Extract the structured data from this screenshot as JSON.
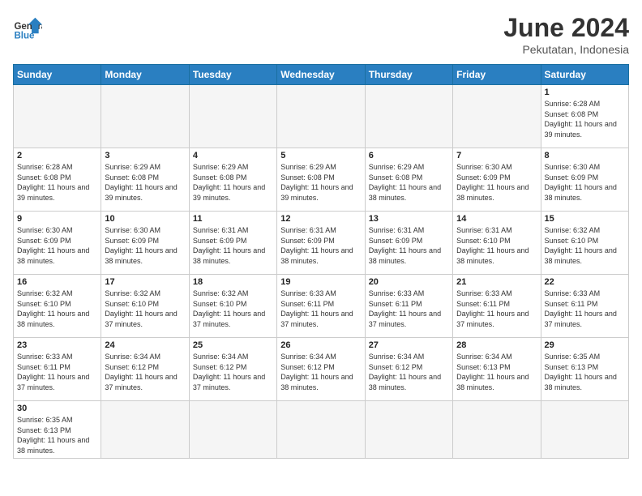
{
  "header": {
    "logo_general": "General",
    "logo_blue": "Blue",
    "month_title": "June 2024",
    "location": "Pekutatan, Indonesia"
  },
  "weekdays": [
    "Sunday",
    "Monday",
    "Tuesday",
    "Wednesday",
    "Thursday",
    "Friday",
    "Saturday"
  ],
  "weeks": [
    [
      {
        "day": "",
        "empty": true
      },
      {
        "day": "",
        "empty": true
      },
      {
        "day": "",
        "empty": true
      },
      {
        "day": "",
        "empty": true
      },
      {
        "day": "",
        "empty": true
      },
      {
        "day": "",
        "empty": true
      },
      {
        "day": "1",
        "sunrise": "6:28 AM",
        "sunset": "6:08 PM",
        "daylight": "11 hours and 39 minutes."
      }
    ],
    [
      {
        "day": "2",
        "sunrise": "6:28 AM",
        "sunset": "6:08 PM",
        "daylight": "11 hours and 39 minutes."
      },
      {
        "day": "3",
        "sunrise": "6:29 AM",
        "sunset": "6:08 PM",
        "daylight": "11 hours and 39 minutes."
      },
      {
        "day": "4",
        "sunrise": "6:29 AM",
        "sunset": "6:08 PM",
        "daylight": "11 hours and 39 minutes."
      },
      {
        "day": "5",
        "sunrise": "6:29 AM",
        "sunset": "6:08 PM",
        "daylight": "11 hours and 39 minutes."
      },
      {
        "day": "6",
        "sunrise": "6:29 AM",
        "sunset": "6:08 PM",
        "daylight": "11 hours and 38 minutes."
      },
      {
        "day": "7",
        "sunrise": "6:30 AM",
        "sunset": "6:09 PM",
        "daylight": "11 hours and 38 minutes."
      },
      {
        "day": "8",
        "sunrise": "6:30 AM",
        "sunset": "6:09 PM",
        "daylight": "11 hours and 38 minutes."
      }
    ],
    [
      {
        "day": "9",
        "sunrise": "6:30 AM",
        "sunset": "6:09 PM",
        "daylight": "11 hours and 38 minutes."
      },
      {
        "day": "10",
        "sunrise": "6:30 AM",
        "sunset": "6:09 PM",
        "daylight": "11 hours and 38 minutes."
      },
      {
        "day": "11",
        "sunrise": "6:31 AM",
        "sunset": "6:09 PM",
        "daylight": "11 hours and 38 minutes."
      },
      {
        "day": "12",
        "sunrise": "6:31 AM",
        "sunset": "6:09 PM",
        "daylight": "11 hours and 38 minutes."
      },
      {
        "day": "13",
        "sunrise": "6:31 AM",
        "sunset": "6:09 PM",
        "daylight": "11 hours and 38 minutes."
      },
      {
        "day": "14",
        "sunrise": "6:31 AM",
        "sunset": "6:10 PM",
        "daylight": "11 hours and 38 minutes."
      },
      {
        "day": "15",
        "sunrise": "6:32 AM",
        "sunset": "6:10 PM",
        "daylight": "11 hours and 38 minutes."
      }
    ],
    [
      {
        "day": "16",
        "sunrise": "6:32 AM",
        "sunset": "6:10 PM",
        "daylight": "11 hours and 38 minutes."
      },
      {
        "day": "17",
        "sunrise": "6:32 AM",
        "sunset": "6:10 PM",
        "daylight": "11 hours and 37 minutes."
      },
      {
        "day": "18",
        "sunrise": "6:32 AM",
        "sunset": "6:10 PM",
        "daylight": "11 hours and 37 minutes."
      },
      {
        "day": "19",
        "sunrise": "6:33 AM",
        "sunset": "6:11 PM",
        "daylight": "11 hours and 37 minutes."
      },
      {
        "day": "20",
        "sunrise": "6:33 AM",
        "sunset": "6:11 PM",
        "daylight": "11 hours and 37 minutes."
      },
      {
        "day": "21",
        "sunrise": "6:33 AM",
        "sunset": "6:11 PM",
        "daylight": "11 hours and 37 minutes."
      },
      {
        "day": "22",
        "sunrise": "6:33 AM",
        "sunset": "6:11 PM",
        "daylight": "11 hours and 37 minutes."
      }
    ],
    [
      {
        "day": "23",
        "sunrise": "6:33 AM",
        "sunset": "6:11 PM",
        "daylight": "11 hours and 37 minutes."
      },
      {
        "day": "24",
        "sunrise": "6:34 AM",
        "sunset": "6:12 PM",
        "daylight": "11 hours and 37 minutes."
      },
      {
        "day": "25",
        "sunrise": "6:34 AM",
        "sunset": "6:12 PM",
        "daylight": "11 hours and 37 minutes."
      },
      {
        "day": "26",
        "sunrise": "6:34 AM",
        "sunset": "6:12 PM",
        "daylight": "11 hours and 38 minutes."
      },
      {
        "day": "27",
        "sunrise": "6:34 AM",
        "sunset": "6:12 PM",
        "daylight": "11 hours and 38 minutes."
      },
      {
        "day": "28",
        "sunrise": "6:34 AM",
        "sunset": "6:13 PM",
        "daylight": "11 hours and 38 minutes."
      },
      {
        "day": "29",
        "sunrise": "6:35 AM",
        "sunset": "6:13 PM",
        "daylight": "11 hours and 38 minutes."
      }
    ],
    [
      {
        "day": "30",
        "sunrise": "6:35 AM",
        "sunset": "6:13 PM",
        "daylight": "11 hours and 38 minutes."
      },
      {
        "day": "",
        "empty": true
      },
      {
        "day": "",
        "empty": true
      },
      {
        "day": "",
        "empty": true
      },
      {
        "day": "",
        "empty": true
      },
      {
        "day": "",
        "empty": true
      },
      {
        "day": "",
        "empty": true
      }
    ]
  ]
}
